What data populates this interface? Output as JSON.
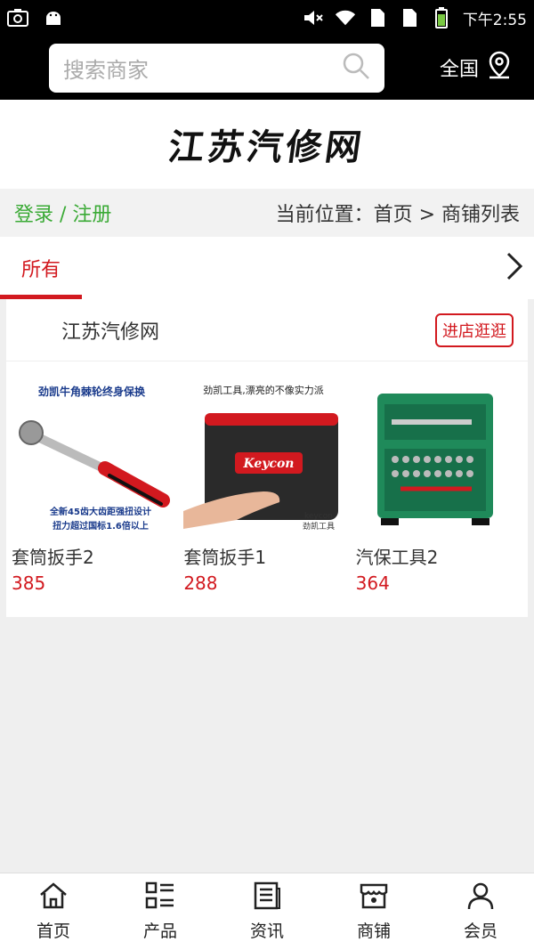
{
  "statusbar": {
    "time": "下午2:55"
  },
  "search": {
    "placeholder": "搜索商家",
    "region": "全国"
  },
  "logo": {
    "text": "江苏汽修网"
  },
  "crumbs": {
    "login": "登录 / 注册",
    "location": "当前位置：首页 > 商铺列表"
  },
  "tabs": {
    "all": "所有"
  },
  "shop": {
    "name": "江苏汽修网",
    "visit_label": "进店逛逛",
    "products": [
      {
        "name": "套筒扳手2",
        "price": "385",
        "banner_top": "劲凯牛角棘轮终身保换",
        "banner_bottom_1": "全新45齿大齿距强扭设计",
        "banner_bottom_2": "扭力超过国标1.6倍以上"
      },
      {
        "name": "套筒扳手1",
        "price": "288",
        "banner_top": "劲凯工具,漂亮的不像实力派",
        "brand": "Keycon",
        "brand_small": "keycon",
        "brand_cn": "劲凯工具"
      },
      {
        "name": "汽保工具2",
        "price": "364"
      }
    ]
  },
  "nav": {
    "items": [
      {
        "label": "首页",
        "icon": "home-icon"
      },
      {
        "label": "产品",
        "icon": "product-grid-icon"
      },
      {
        "label": "资讯",
        "icon": "news-icon"
      },
      {
        "label": "商铺",
        "icon": "store-icon"
      },
      {
        "label": "会员",
        "icon": "member-icon"
      }
    ]
  },
  "colors": {
    "accent": "#d2191f",
    "login_green": "#3aaa35",
    "header_bg": "#000000"
  }
}
